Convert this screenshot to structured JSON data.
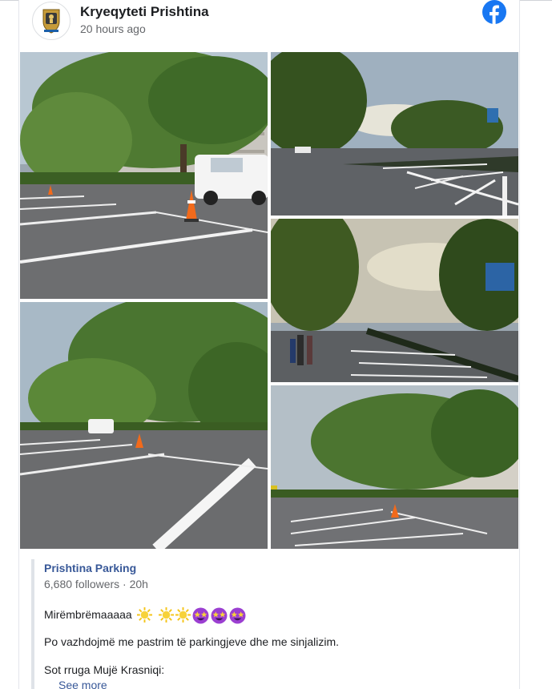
{
  "post": {
    "author": "Kryeqyteti Prishtina",
    "time": "20 hours ago",
    "avatar_icon": "prishtina-crest-icon",
    "network_icon": "facebook-icon",
    "photo_alt": [
      "parking-lot-photo-1",
      "parking-lot-photo-2",
      "parking-lot-photo-3",
      "parking-lot-photo-4",
      "parking-lot-photo-5"
    ]
  },
  "shared": {
    "page_name": "Prishtina Parking",
    "followers": "6,680 followers · 20h",
    "greeting": "Mirëmbrëmaaaaa",
    "line1": "Po vazhdojmë me pastrim të parkingjeve dhe me sinjalizim.",
    "line2": "Sot rruga Mujë Krasniqi:",
    "see_more": "See more"
  },
  "colors": {
    "link": "#385898",
    "facebook_blue": "#1877f2",
    "muted": "#65676b"
  }
}
